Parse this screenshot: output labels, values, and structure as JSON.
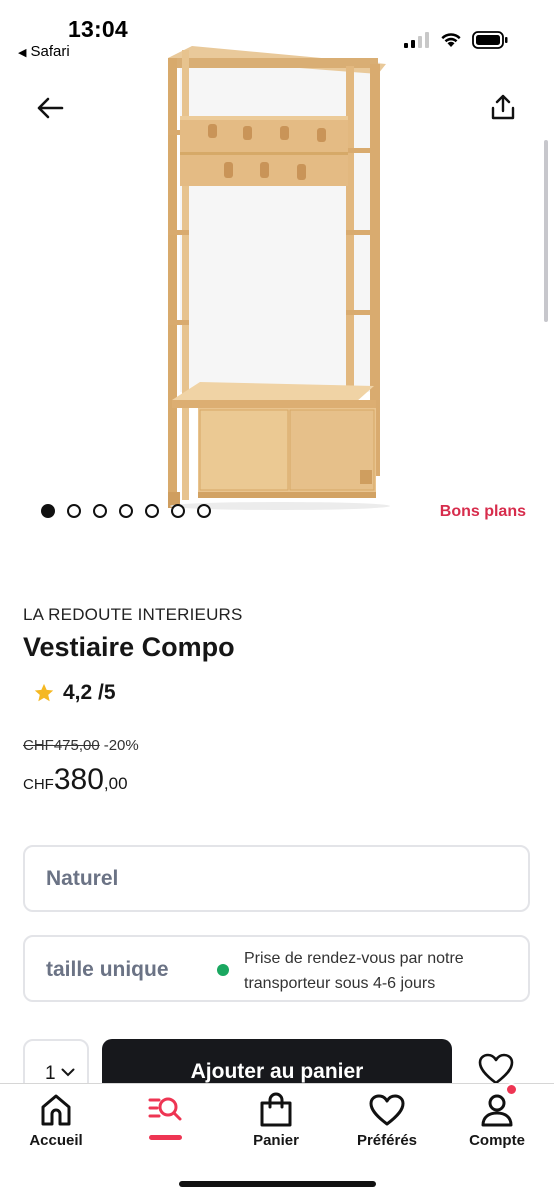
{
  "status_bar": {
    "time": "13:04",
    "back_app": "Safari",
    "icons": [
      "signal-icon",
      "wifi-icon",
      "battery-icon"
    ]
  },
  "nav": {
    "back_icon": "arrow-left-icon",
    "share_icon": "share-icon"
  },
  "gallery": {
    "image": "coat-rack-wardrobe-image",
    "dots_total": 7,
    "active_dot": 1,
    "badge": "Bons plans"
  },
  "product": {
    "brand": "LA REDOUTE INTERIEURS",
    "title": "Vestiaire Compo",
    "rating": "4,2 /5",
    "old_price": "CHF475,00",
    "discount": "-20%",
    "price_currency": "CHF",
    "price_integer": "380",
    "price_decimals": ",00"
  },
  "options": {
    "color": "Naturel",
    "size": "taille unique",
    "delivery": "Prise de rendez-vous par notre transporteur sous 4-6 jours"
  },
  "cart": {
    "quantity": "1",
    "add_button": "Ajouter au panier"
  },
  "tabbar": {
    "items": [
      {
        "label": "Accueil",
        "icon": "home-icon"
      },
      {
        "label": "",
        "icon": "search-list-icon"
      },
      {
        "label": "Panier",
        "icon": "shopping-bag-icon"
      },
      {
        "label": "Préférés",
        "icon": "heart-icon"
      },
      {
        "label": "Compte",
        "icon": "user-icon"
      }
    ]
  },
  "colors": {
    "accent": "#d72c4c",
    "tab_accent": "#ee3553",
    "button_dark": "#17181c",
    "muted_text": "#6b7385",
    "green": "#1aa760"
  }
}
